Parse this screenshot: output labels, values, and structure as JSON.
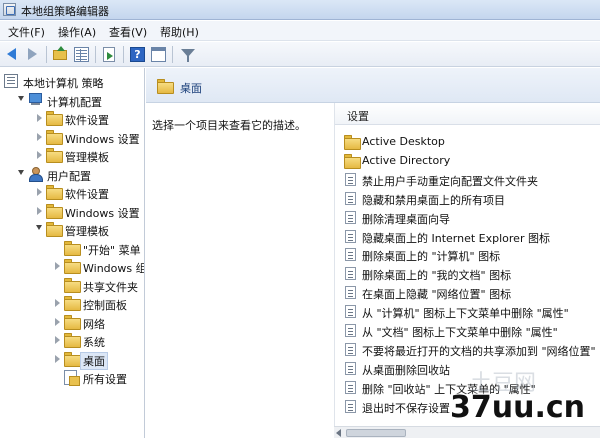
{
  "window": {
    "title": "本地组策略编辑器"
  },
  "menu": [
    "文件(F)",
    "操作(A)",
    "查看(V)",
    "帮助(H)"
  ],
  "toolbar": {
    "buttons": [
      "back-arrow-icon",
      "forward-arrow-icon",
      "up-folder-icon",
      "show-hide-tree-icon",
      "export-list-icon",
      "help-icon",
      "properties-window-icon",
      "filter-icon"
    ]
  },
  "tree": {
    "items": [
      {
        "label": "本地计算机 策略",
        "icon": "policy-root-icon",
        "indent": 0,
        "expander": "none"
      },
      {
        "label": "计算机配置",
        "icon": "computer-icon",
        "indent": 1,
        "expander": "open"
      },
      {
        "label": "软件设置",
        "icon": "folder-icon",
        "indent": 2,
        "expander": "closed"
      },
      {
        "label": "Windows 设置",
        "icon": "folder-icon",
        "indent": 2,
        "expander": "closed"
      },
      {
        "label": "管理模板",
        "icon": "folder-icon",
        "indent": 2,
        "expander": "closed"
      },
      {
        "label": "用户配置",
        "icon": "user-icon",
        "indent": 1,
        "expander": "open"
      },
      {
        "label": "软件设置",
        "icon": "folder-icon",
        "indent": 2,
        "expander": "closed"
      },
      {
        "label": "Windows 设置",
        "icon": "folder-icon",
        "indent": 2,
        "expander": "closed"
      },
      {
        "label": "管理模板",
        "icon": "folder-icon",
        "indent": 2,
        "expander": "open"
      },
      {
        "label": "\"开始\" 菜单",
        "icon": "folder-icon",
        "indent": 3,
        "expander": "none"
      },
      {
        "label": "Windows 组件",
        "icon": "folder-icon",
        "indent": 3,
        "expander": "closed"
      },
      {
        "label": "共享文件夹",
        "icon": "folder-icon",
        "indent": 3,
        "expander": "none"
      },
      {
        "label": "控制面板",
        "icon": "folder-icon",
        "indent": 3,
        "expander": "closed"
      },
      {
        "label": "网络",
        "icon": "folder-icon",
        "indent": 3,
        "expander": "closed"
      },
      {
        "label": "系统",
        "icon": "folder-icon",
        "indent": 3,
        "expander": "closed"
      },
      {
        "label": "桌面",
        "icon": "folder-icon",
        "indent": 3,
        "expander": "closed",
        "selected": true
      },
      {
        "label": "所有设置",
        "icon": "allset-icon",
        "indent": 3,
        "expander": "none"
      }
    ]
  },
  "main": {
    "header_title": "桌面",
    "description": "选择一个项目来查看它的描述。",
    "column_header": "设置",
    "items": [
      {
        "label": "Active Desktop",
        "type": "folder"
      },
      {
        "label": "Active Directory",
        "type": "folder"
      },
      {
        "label": "禁止用户手动重定向配置文件文件夹",
        "type": "setting"
      },
      {
        "label": "隐藏和禁用桌面上的所有项目",
        "type": "setting"
      },
      {
        "label": "删除清理桌面向导",
        "type": "setting"
      },
      {
        "label": "隐藏桌面上的 Internet Explorer 图标",
        "type": "setting"
      },
      {
        "label": "删除桌面上的 \"计算机\" 图标",
        "type": "setting"
      },
      {
        "label": "删除桌面上的 \"我的文档\" 图标",
        "type": "setting"
      },
      {
        "label": "在桌面上隐藏 \"网络位置\" 图标",
        "type": "setting"
      },
      {
        "label": "从 \"计算机\" 图标上下文菜单中删除 \"属性\"",
        "type": "setting"
      },
      {
        "label": "从 \"文档\" 图标上下文菜单中删除 \"属性\"",
        "type": "setting"
      },
      {
        "label": "不要将最近打开的文档的共享添加到 \"网络位置\"",
        "type": "setting"
      },
      {
        "label": "从桌面删除回收站",
        "type": "setting"
      },
      {
        "label": "删除 \"回收站\" 上下文菜单的 \"属性\"",
        "type": "setting"
      },
      {
        "label": "退出时不保存设置",
        "type": "setting"
      }
    ]
  },
  "watermark": {
    "text": "37uu.cn",
    "faint_text": "土豆网"
  }
}
